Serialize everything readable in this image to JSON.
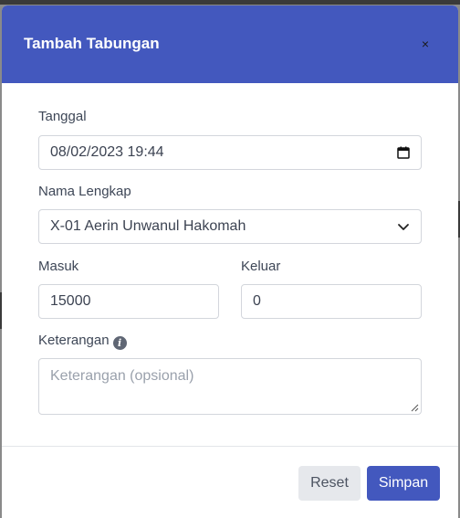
{
  "modal": {
    "title": "Tambah Tabungan",
    "close_label": "×"
  },
  "form": {
    "tanggal": {
      "label": "Tanggal",
      "value": "08/02/2023 19:44",
      "icon": "calendar-icon"
    },
    "nama": {
      "label": "Nama Lengkap",
      "selected": "X-01 Aerin Unwanul Hakomah",
      "icon": "chevron-down-icon"
    },
    "masuk": {
      "label": "Masuk",
      "value": "15000"
    },
    "keluar": {
      "label": "Keluar",
      "value": "0"
    },
    "keterangan": {
      "label": "Keterangan",
      "info_icon": "i",
      "placeholder": "Keterangan (opsional)"
    }
  },
  "footer": {
    "reset_label": "Reset",
    "save_label": "Simpan"
  },
  "colors": {
    "primary": "#4358be",
    "reset_bg": "#e6e8ec",
    "border": "#d3d6dc"
  }
}
